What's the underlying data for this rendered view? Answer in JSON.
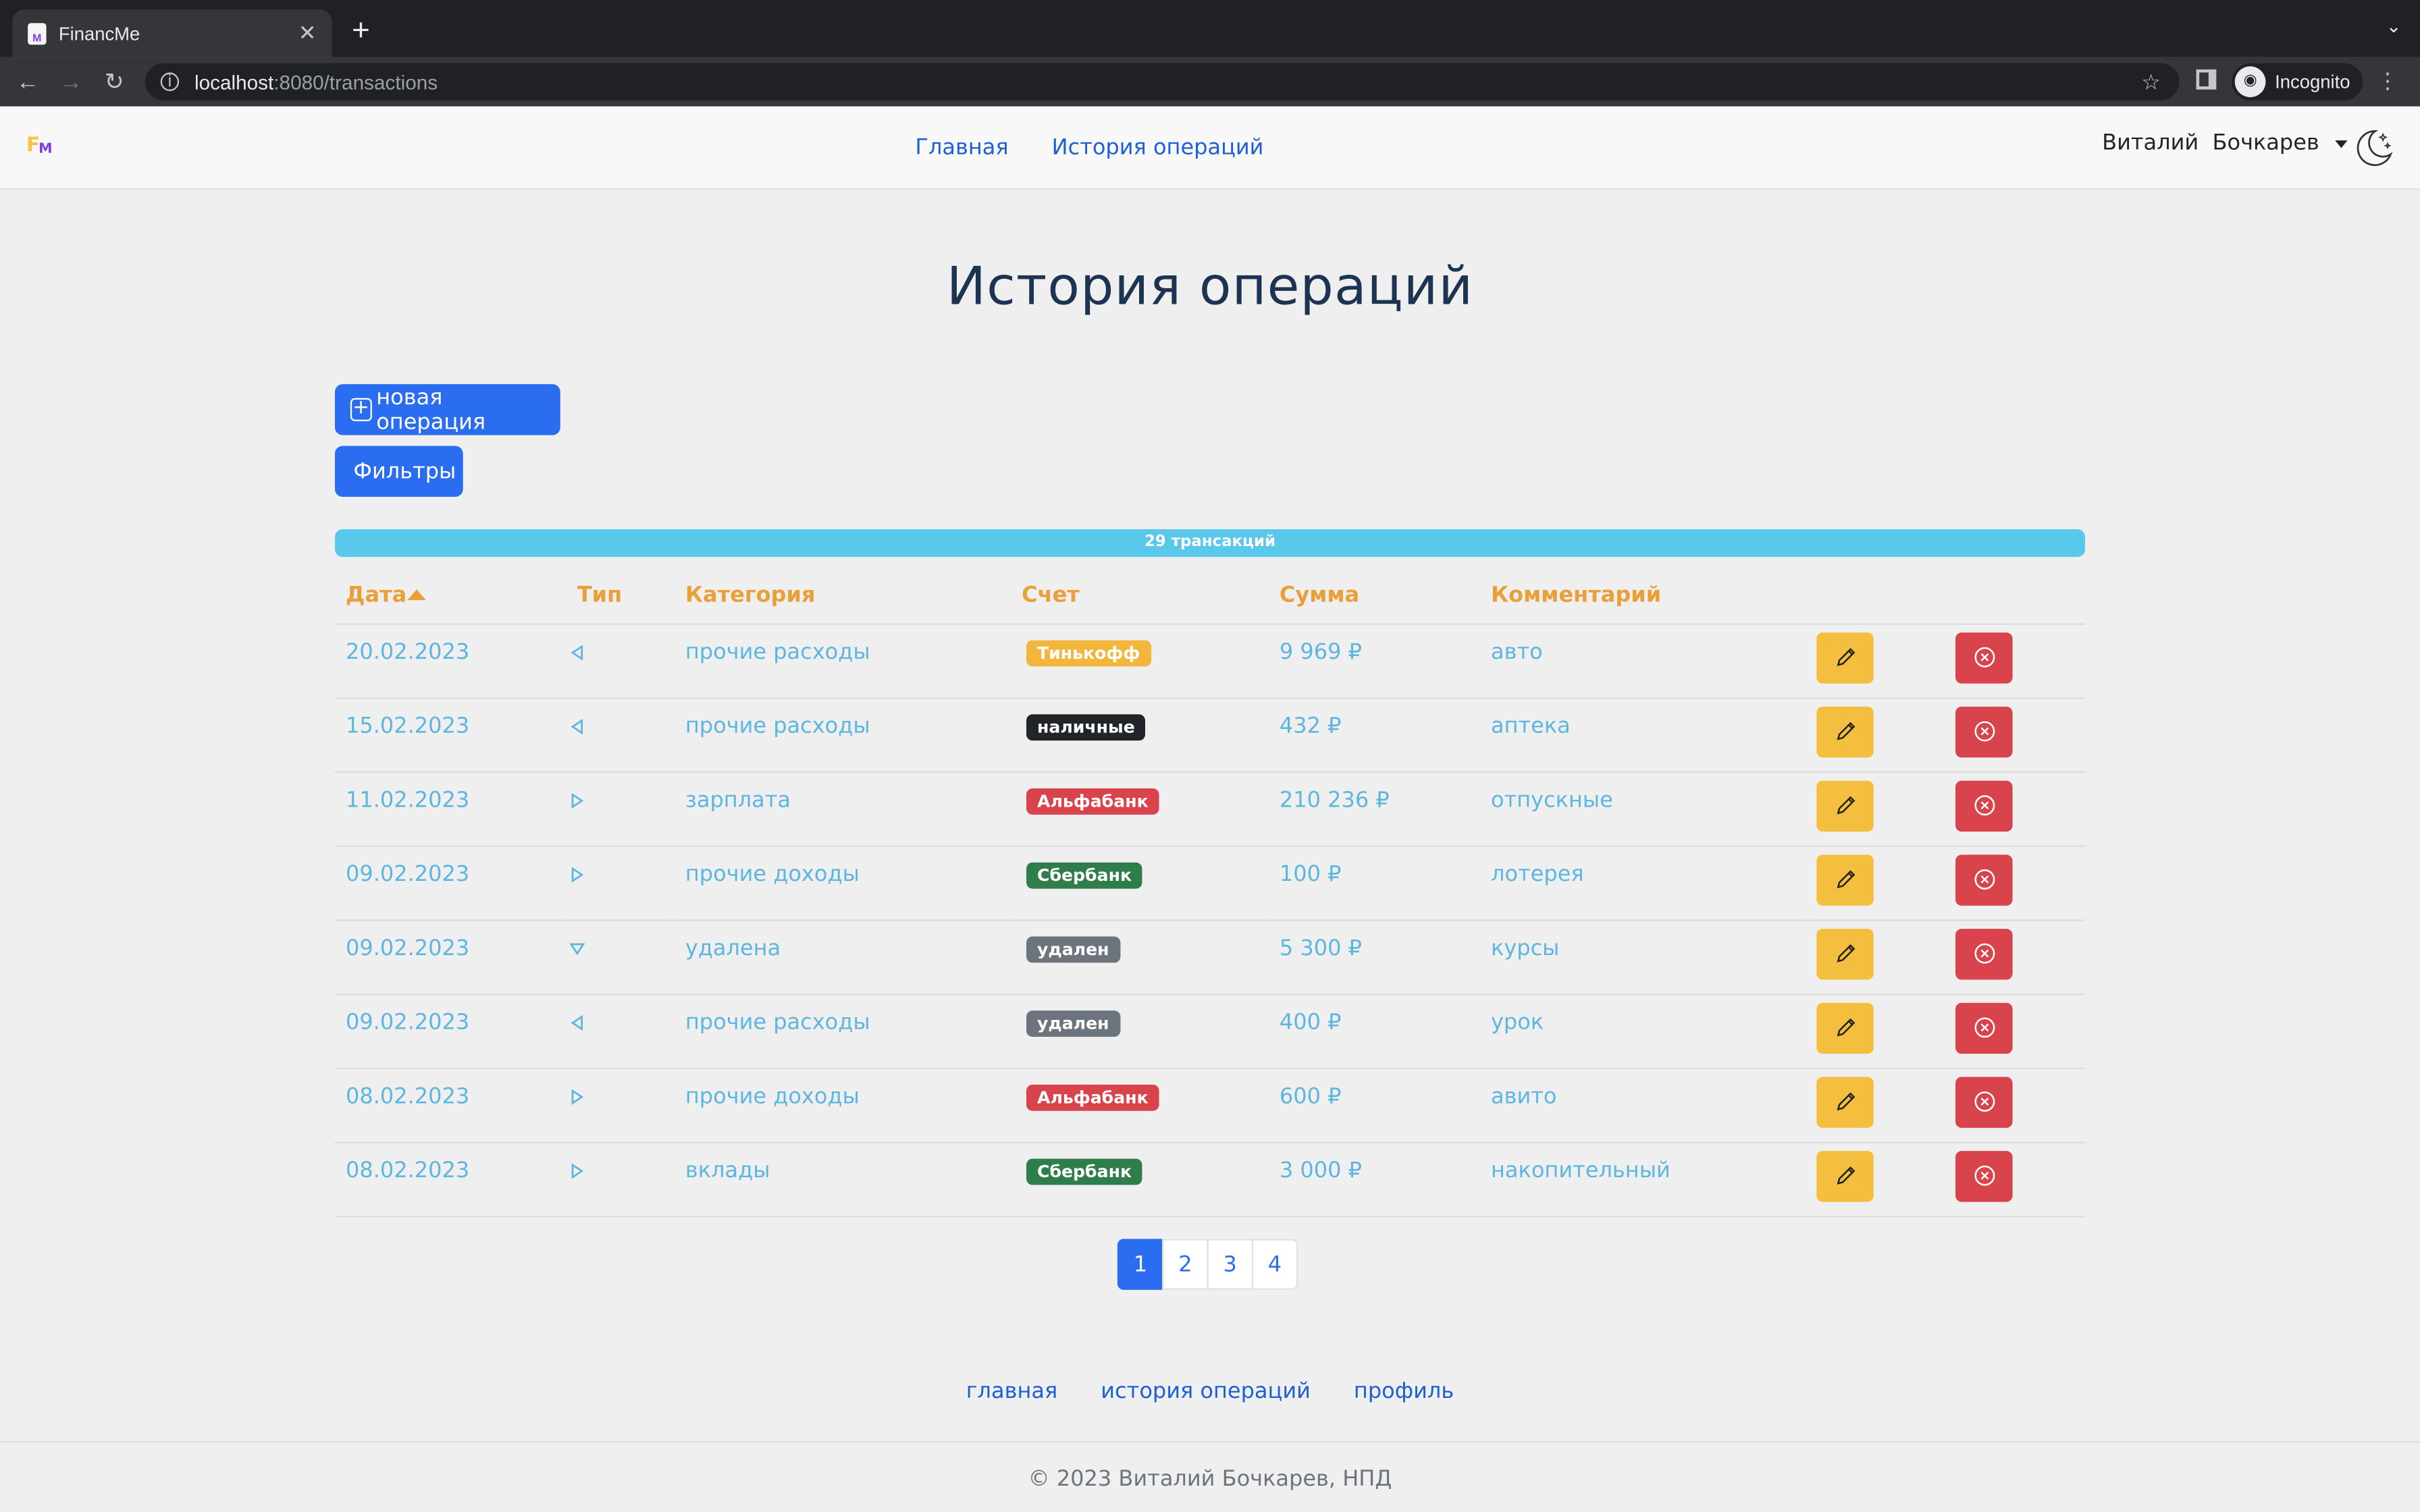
{
  "browser": {
    "tab_title": "FinancMe",
    "url_host": "localhost",
    "url_path": ":8080/transactions",
    "profile_label": "Incognito"
  },
  "navbar": {
    "logo_f": "F",
    "logo_m": "M",
    "links": [
      "Главная",
      "История операций"
    ],
    "user_name": "Виталий  Бочкарев"
  },
  "page": {
    "title": "История операций",
    "new_button": "новая операция",
    "filter_button": "Фильтры",
    "count_label": "29 трансакций"
  },
  "table": {
    "headers": [
      "Дата",
      "Тип",
      "Категория",
      "Счет",
      "Сумма",
      "Комментарий"
    ],
    "rows": [
      {
        "date": "20.02.2023",
        "type": "expense",
        "category": "прочие расходы",
        "account": "Тинькофф",
        "account_color": "#f2b63c",
        "amount": "9 969 ₽",
        "comment": "авто"
      },
      {
        "date": "15.02.2023",
        "type": "expense",
        "category": "прочие расходы",
        "account": "наличные",
        "account_color": "#212529",
        "amount": "432 ₽",
        "comment": "аптека"
      },
      {
        "date": "11.02.2023",
        "type": "income",
        "category": "зарплата",
        "account": "Альфабанк",
        "account_color": "#d9434c",
        "amount": "210 236 ₽",
        "comment": "отпускные"
      },
      {
        "date": "09.02.2023",
        "type": "income",
        "category": "прочие доходы",
        "account": "Сбербанк",
        "account_color": "#2f7d4b",
        "amount": "100 ₽",
        "comment": "лотерея"
      },
      {
        "date": "09.02.2023",
        "type": "deleted",
        "category": "удалена",
        "account": "удален",
        "account_color": "#6c757d",
        "amount": "5 300 ₽",
        "comment": "курсы"
      },
      {
        "date": "09.02.2023",
        "type": "expense",
        "category": "прочие расходы",
        "account": "удален",
        "account_color": "#6c757d",
        "amount": "400 ₽",
        "comment": "урок"
      },
      {
        "date": "08.02.2023",
        "type": "income",
        "category": "прочие доходы",
        "account": "Альфабанк",
        "account_color": "#d9434c",
        "amount": "600 ₽",
        "comment": "авито"
      },
      {
        "date": "08.02.2023",
        "type": "income",
        "category": "вклады",
        "account": "Сбербанк",
        "account_color": "#2f7d4b",
        "amount": "3 000 ₽",
        "comment": "накопительный"
      }
    ]
  },
  "pagination": [
    "1",
    "2",
    "3",
    "4"
  ],
  "footer": {
    "links": [
      "главная",
      "история операций",
      "профиль"
    ],
    "copyright": "© 2023 Виталий Бочкарев, НПД"
  }
}
